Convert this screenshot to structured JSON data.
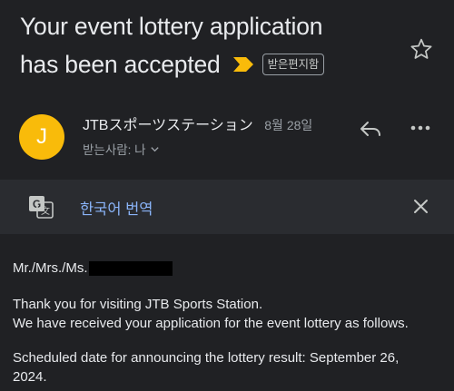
{
  "email": {
    "subject_line1": "Your event lottery application",
    "subject_line2": "has been accepted",
    "label": "받은편지함",
    "important_icon": "importance-marker-icon",
    "star_icon": "star-icon"
  },
  "sender": {
    "avatar_letter": "J",
    "name": "JTBスポーツステーション",
    "date": "8월 28일",
    "recipient": "받는사람: 나",
    "avatar_color": "#f9bb0a"
  },
  "translate": {
    "label": "한국어 번역",
    "accent": "#8ab4f8"
  },
  "body": {
    "greeting": "Mr./Mrs./Ms.",
    "line1": "Thank you for visiting JTB Sports Station.",
    "line2": "We have received your application for the event lottery as follows.",
    "line3": "Scheduled date for announcing the lottery result: September 26,",
    "line4": "2024."
  }
}
